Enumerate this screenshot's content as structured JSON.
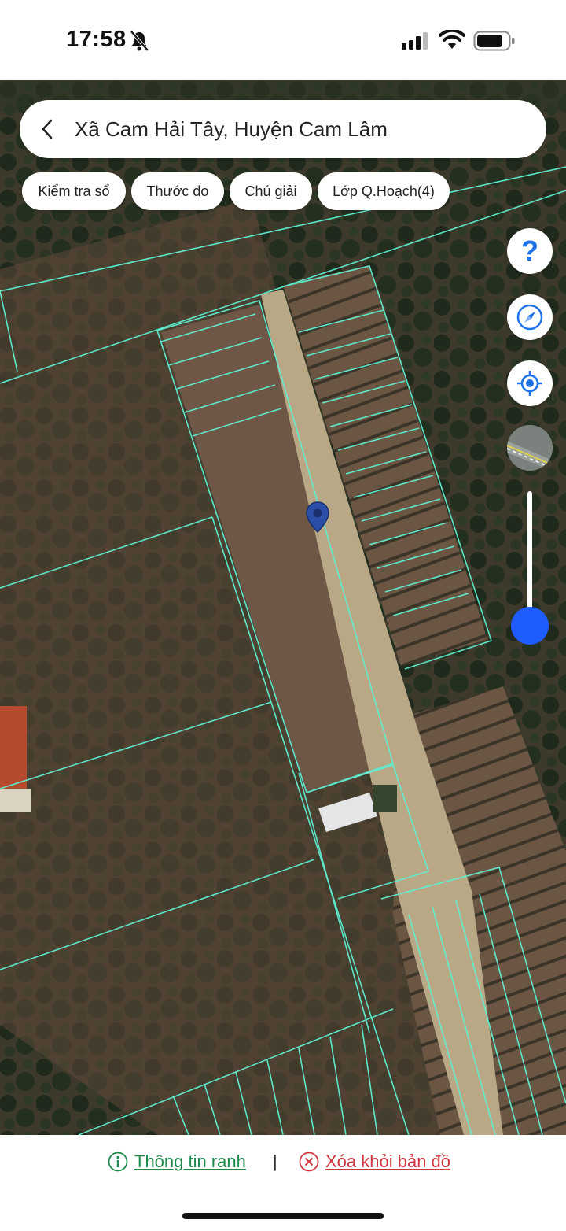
{
  "status_bar": {
    "time": "17:58",
    "icons": [
      "bell-slash-icon",
      "cellular-signal-icon",
      "wifi-icon",
      "battery-icon"
    ]
  },
  "search": {
    "title": "Xã Cam Hải Tây, Huyện Cam Lâm"
  },
  "chips": [
    {
      "label": "Kiểm tra sổ"
    },
    {
      "label": "Thước đo"
    },
    {
      "label": "Chú giải"
    },
    {
      "label": "Lớp Q.Hoạch(4)"
    }
  ],
  "controls": {
    "help": "?",
    "icons": [
      "help-icon",
      "compass-icon",
      "my-location-icon",
      "map-layer-icon"
    ],
    "zoom_level": 1.0
  },
  "bottom": {
    "info_label": "Thông tin ranh",
    "separator": "|",
    "remove_label": "Xóa khỏi bản đồ"
  },
  "colors": {
    "info_green": "#1d8a4c",
    "remove_red": "#d0353f",
    "zoom_blue": "#1f5cff",
    "parcel_line": "#5ff0d2"
  }
}
